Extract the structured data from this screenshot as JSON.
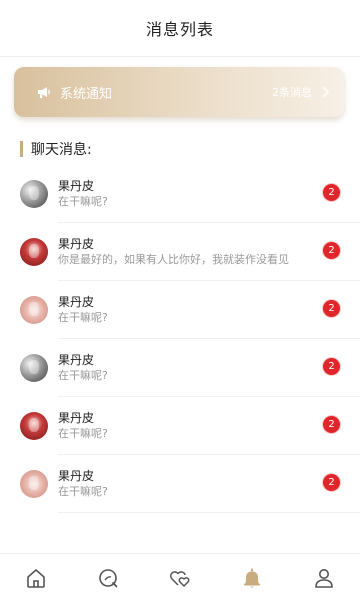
{
  "header": {
    "title": "消息列表"
  },
  "system_notice": {
    "label": "系统通知",
    "count": "2条消息",
    "icon": "megaphone-icon",
    "chevron": "chevron-right-icon"
  },
  "chat_section": {
    "title": "聊天消息:"
  },
  "chats": [
    {
      "name": "果丹皮",
      "message": "在干嘛呢?",
      "unread": "2",
      "avatar_style": "gray"
    },
    {
      "name": "果丹皮",
      "message": "你是最好的，如果有人比你好，我就装作没看见",
      "unread": "2",
      "avatar_style": "red"
    },
    {
      "name": "果丹皮",
      "message": "在干嘛呢?",
      "unread": "2",
      "avatar_style": "pink"
    },
    {
      "name": "果丹皮",
      "message": "在干嘛呢?",
      "unread": "2",
      "avatar_style": "gray"
    },
    {
      "name": "果丹皮",
      "message": "在干嘛呢?",
      "unread": "2",
      "avatar_style": "red"
    },
    {
      "name": "果丹皮",
      "message": "在干嘛呢?",
      "unread": "2",
      "avatar_style": "pink"
    }
  ],
  "tabbar": {
    "items": [
      {
        "icon": "home-icon",
        "active": false
      },
      {
        "icon": "discover-icon",
        "active": false
      },
      {
        "icon": "hearts-icon",
        "active": false
      },
      {
        "icon": "bell-icon",
        "active": true
      },
      {
        "icon": "profile-icon",
        "active": false
      }
    ]
  },
  "colors": {
    "accent": "#c8ab7e",
    "badge": "#e0262b",
    "icon": "#555555"
  }
}
